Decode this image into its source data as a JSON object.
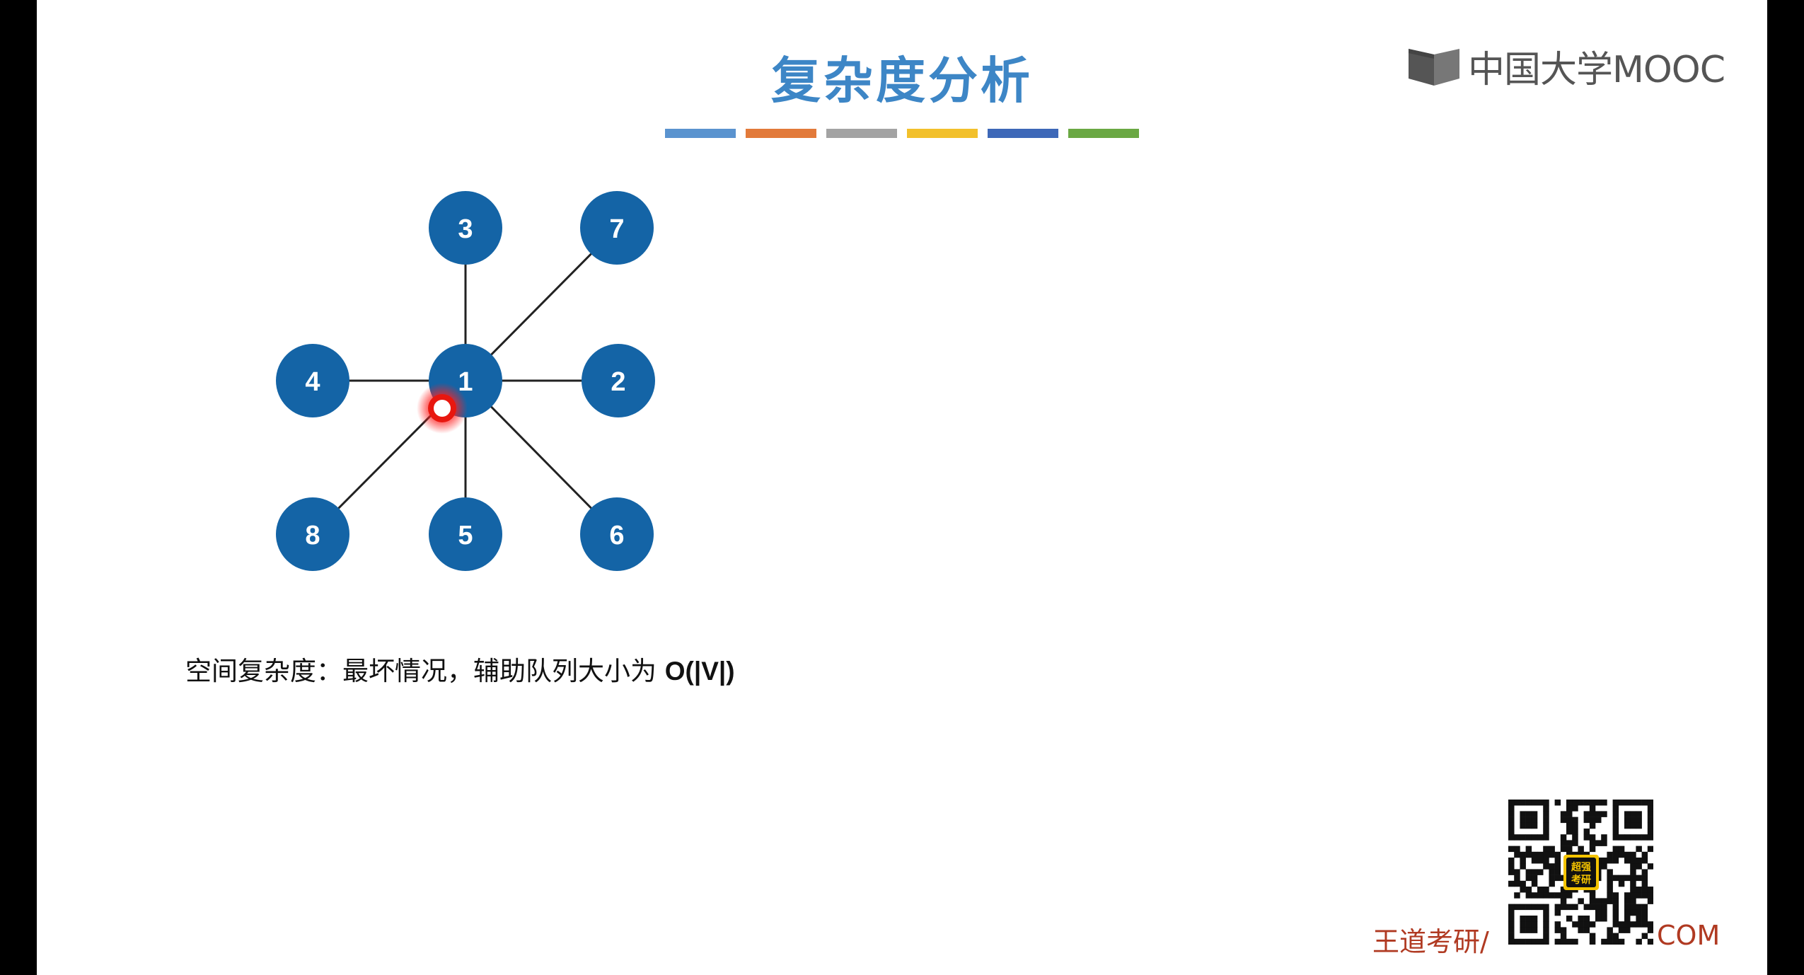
{
  "slide": {
    "title": "复杂度分析",
    "accent_colors": [
      "#5a93cf",
      "#e27a3a",
      "#a3a3a3",
      "#f2c02b",
      "#3d68b8",
      "#6aa843"
    ],
    "logo_text": "中国大学MOOC",
    "caption": {
      "prefix": "空间复杂度：最坏情况，辅助队列大小为 ",
      "formula": "O(|V|)"
    },
    "footer": {
      "left": "王道考研/",
      "right": "COM"
    },
    "qr_center_text": [
      "超强",
      "考研"
    ]
  },
  "graph": {
    "node_color": "#1464a6",
    "edge_color": "#222222",
    "nodes": [
      {
        "id": "1",
        "label": "1"
      },
      {
        "id": "2",
        "label": "2"
      },
      {
        "id": "3",
        "label": "3"
      },
      {
        "id": "4",
        "label": "4"
      },
      {
        "id": "5",
        "label": "5"
      },
      {
        "id": "6",
        "label": "6"
      },
      {
        "id": "7",
        "label": "7"
      },
      {
        "id": "8",
        "label": "8"
      }
    ],
    "edges": [
      [
        "1",
        "2"
      ],
      [
        "1",
        "3"
      ],
      [
        "1",
        "4"
      ],
      [
        "1",
        "5"
      ],
      [
        "1",
        "6"
      ],
      [
        "1",
        "7"
      ],
      [
        "1",
        "8"
      ]
    ]
  }
}
